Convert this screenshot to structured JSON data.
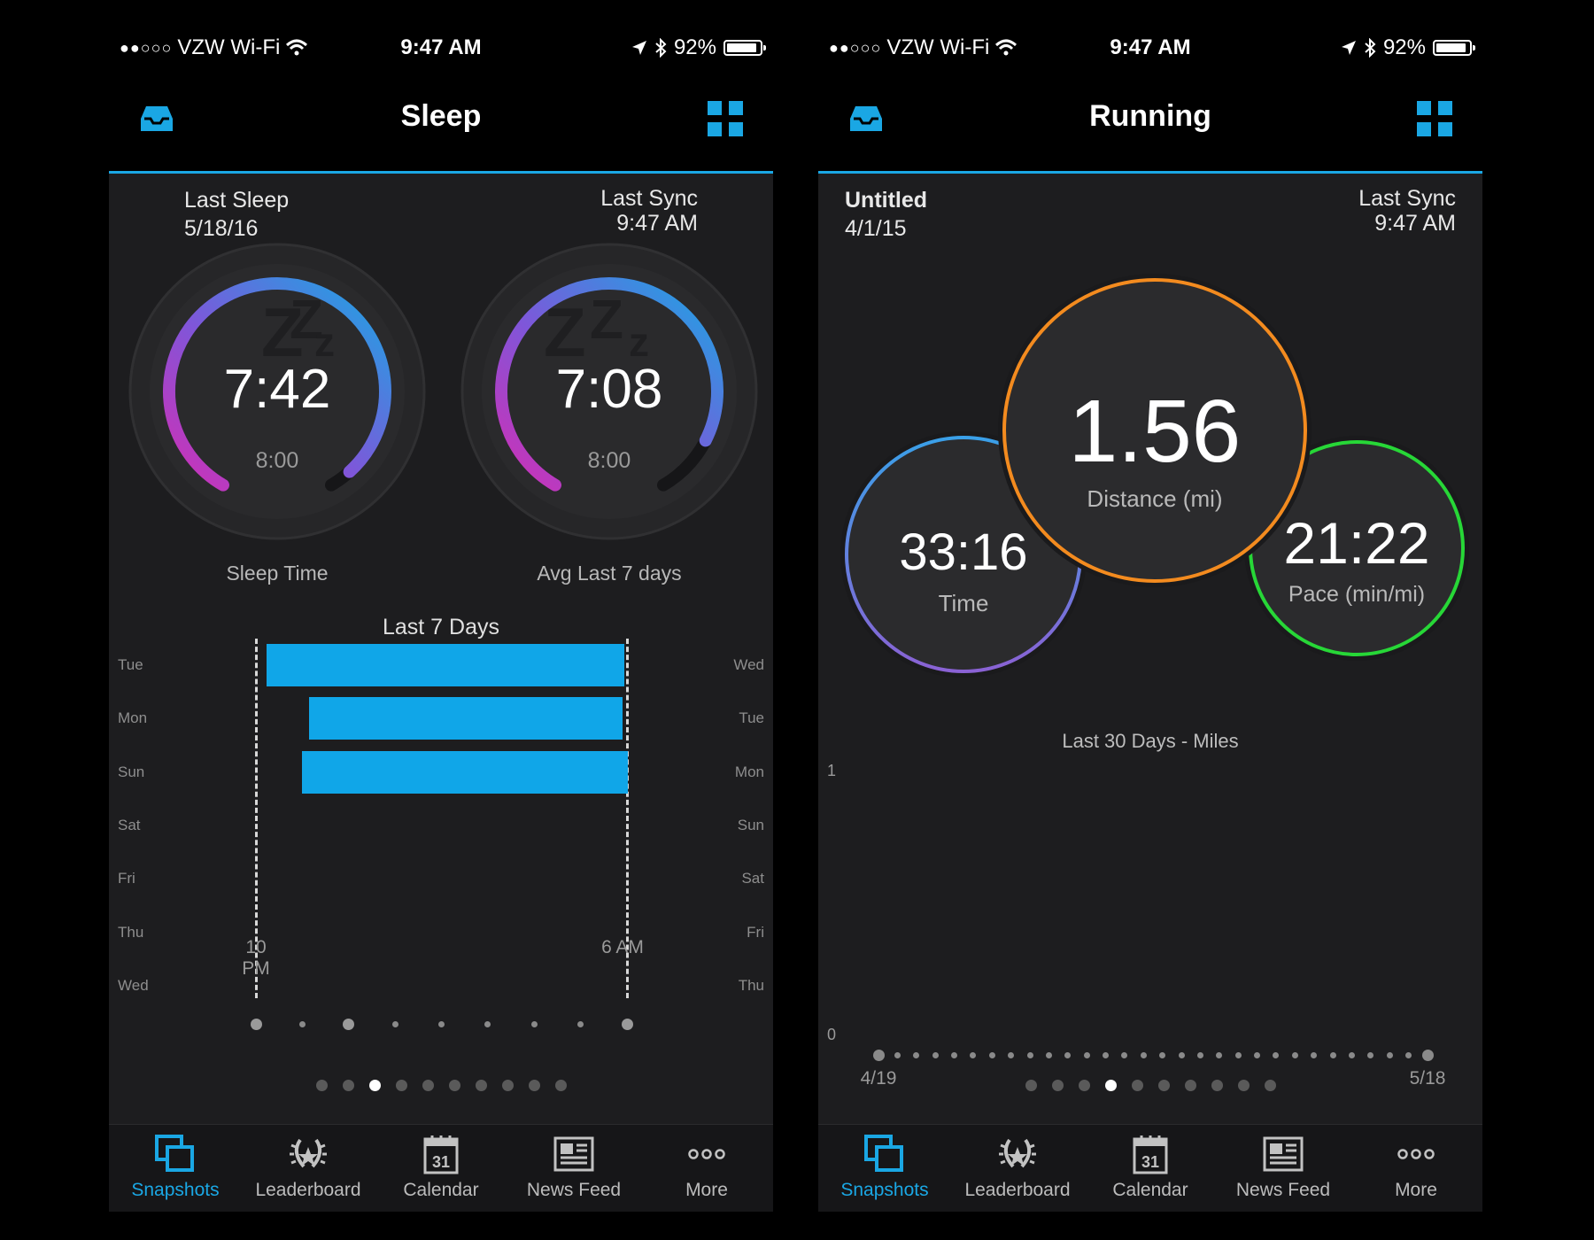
{
  "status": {
    "signal": "●●○○○",
    "carrier": "VZW Wi-Fi",
    "time": "9:47 AM",
    "battery": "92%",
    "battery_level": 0.92
  },
  "sleep_screen": {
    "title": "Sleep",
    "last_sleep_label": "Last Sleep",
    "last_sleep_date": "5/18/16",
    "last_sync_label": "Last Sync",
    "last_sync_time": "9:47 AM",
    "gauges": [
      {
        "value": "7:42",
        "goal": "8:00",
        "label": "Sleep Time",
        "fraction": 0.96
      },
      {
        "value": "7:08",
        "goal": "8:00",
        "label": "Avg Last 7 days",
        "fraction": 0.89
      }
    ],
    "chart": {
      "title": "Last 7 Days",
      "left_days": [
        "Tue",
        "Mon",
        "Sun",
        "Sat",
        "Fri",
        "Thu",
        "Wed"
      ],
      "right_days": [
        "Wed",
        "Tue",
        "Mon",
        "Sun",
        "Sat",
        "Fri",
        "Thu"
      ],
      "x_start": "10 PM",
      "x_end": "6 AM",
      "bars": [
        {
          "start": 0.03,
          "end": 0.99
        },
        {
          "start": 0.145,
          "end": 0.985
        },
        {
          "start": 0.125,
          "end": 1.0
        }
      ],
      "color": "#10a6e8"
    },
    "pager_total": 10,
    "pager_active": 2
  },
  "running_screen": {
    "title": "Running",
    "activity_name": "Untitled",
    "activity_date": "4/1/15",
    "last_sync_label": "Last Sync",
    "last_sync_time": "9:47 AM",
    "distance": {
      "value": "1.56",
      "label": "Distance (mi)",
      "color": "#f38b1f"
    },
    "time": {
      "value": "33:16",
      "label": "Time",
      "color": "#3aa0e8"
    },
    "pace": {
      "value": "21:22",
      "label": "Pace (min/mi)",
      "color": "#27d737"
    },
    "chart": {
      "title": "Last 30 Days - Miles",
      "y_max": "1",
      "y_min": "0",
      "x_start": "4/19",
      "x_end": "5/18",
      "points": 30
    },
    "pager_total": 10,
    "pager_active": 3
  },
  "tabbar": {
    "items": [
      "Snapshots",
      "Leaderboard",
      "Calendar",
      "News Feed",
      "More"
    ],
    "calendar_day": "31",
    "active": 0,
    "accent": "#1aa7e4"
  }
}
